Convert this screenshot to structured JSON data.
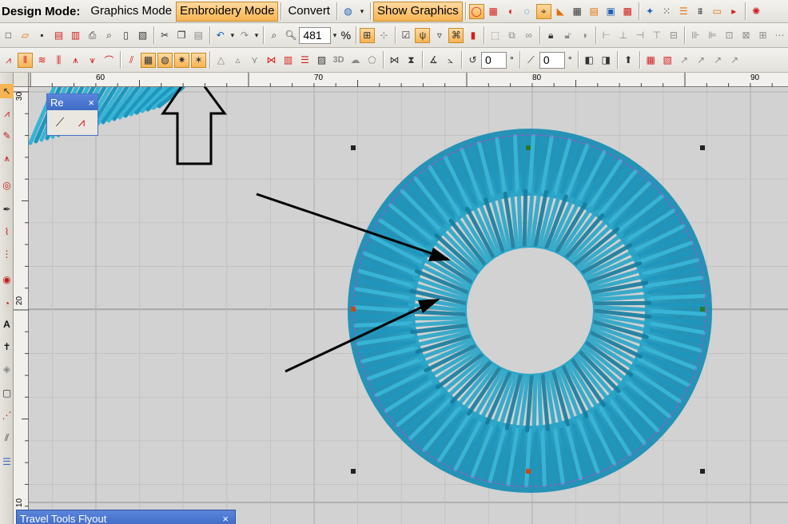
{
  "modebar": {
    "title": "Design Mode:",
    "modes": [
      {
        "label": "Graphics Mode",
        "active": false
      },
      {
        "label": "Embroidery Mode",
        "active": true
      },
      {
        "label": "Convert",
        "active": false
      }
    ],
    "show_graphics": {
      "label": "Show Graphics",
      "active": true
    }
  },
  "stdbar": {
    "zoom_value": "481",
    "zoom_unit": "%"
  },
  "stitchbar": {
    "rotate_value": "0",
    "rotate_unit": "°",
    "slant_value": "0",
    "slant_unit": "°",
    "three_d_label": "3D"
  },
  "rulers": {
    "horizontal": [
      "60",
      "70",
      "80",
      "90"
    ],
    "vertical": [
      "30",
      "20",
      "10"
    ]
  },
  "flyouts": {
    "re": {
      "title": "Re",
      "close": "×"
    },
    "travel": {
      "title": "Travel Tools Flyout",
      "close": "×"
    }
  },
  "colors": {
    "accent": "#f6b452",
    "thread": "#2aa6c9",
    "thread_dark": "#0c6f8f",
    "canvas": "#d2d2d2",
    "grid": "#9a9a9a",
    "guide": "#d13bd1"
  },
  "icons": {
    "annotation": "hollow-up-arrow",
    "pointers": "black-arrows"
  }
}
